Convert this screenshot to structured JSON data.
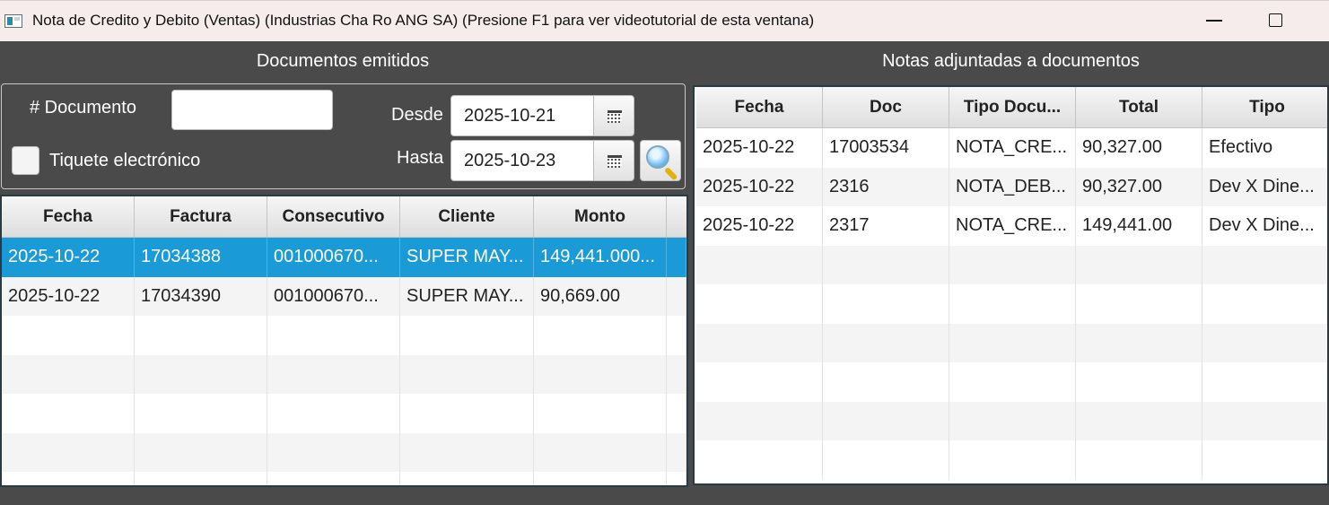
{
  "window": {
    "title": "Nota de Credito y Debito (Ventas) (Industrias Cha Ro ANG SA) (Presione F1 para ver videotutorial de esta ventana)"
  },
  "left_section": {
    "title": "Documentos emitidos",
    "doc_label": "# Documento",
    "doc_value": "",
    "tiquete_label": "Tiquete electrónico",
    "tiquete_checked": false,
    "desde_label": "Desde",
    "desde_value": "2025-10-21",
    "hasta_label": "Hasta",
    "hasta_value": "2025-10-23",
    "table": {
      "columns": [
        "Fecha",
        "Factura",
        "Consecutivo",
        "Cliente",
        "Monto"
      ],
      "rows": [
        [
          "2025-10-22",
          "17034388",
          "001000670...",
          "SUPER MAY...",
          "149,441.000..."
        ],
        [
          "2025-10-22",
          "17034390",
          "001000670...",
          "SUPER MAY...",
          "90,669.00"
        ]
      ],
      "selected_row": 0
    }
  },
  "right_section": {
    "title": "Notas adjuntadas a documentos",
    "table": {
      "columns": [
        "Fecha",
        "Doc",
        "Tipo Docu...",
        "Total",
        "Tipo"
      ],
      "rows": [
        [
          "2025-10-22",
          "17003534",
          "NOTA_CRE...",
          "90,327.00",
          "Efectivo"
        ],
        [
          "2025-10-22",
          "2316",
          "NOTA_DEB...",
          "90,327.00",
          "Dev X Dine..."
        ],
        [
          "2025-10-22",
          "2317",
          "NOTA_CRE...",
          "149,441.00",
          "Dev X Dine..."
        ]
      ]
    }
  },
  "colors": {
    "background": "#4a4a4a",
    "titlebar": "#f7ecec",
    "selection": "#1a9ad6"
  },
  "icons": {
    "app": "app-window-icon",
    "minimize": "minimize-icon",
    "maximize": "maximize-icon",
    "calendar": "calendar-icon",
    "search": "magnifier-search-icon"
  }
}
